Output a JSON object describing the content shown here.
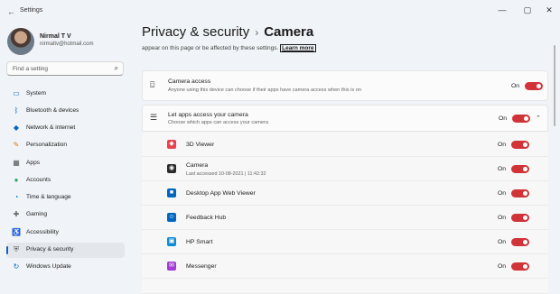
{
  "window": {
    "title": "Settings",
    "minimize": "—",
    "maximize": "▢",
    "close": "✕"
  },
  "user": {
    "name": "Nirmal T V",
    "email": "nirmaltv@hotmail.com"
  },
  "search": {
    "placeholder": "Find a setting",
    "icon": "search-icon"
  },
  "sidebar": {
    "items": [
      {
        "label": "System",
        "icon": "monitor-icon",
        "color": "#0067c0"
      },
      {
        "label": "Bluetooth & devices",
        "icon": "bluetooth-icon",
        "color": "#0067c0"
      },
      {
        "label": "Network & internet",
        "icon": "wifi-diamond-icon",
        "color": "#0067c0"
      },
      {
        "label": "Personalization",
        "icon": "brush-icon",
        "color": "#e07a2e"
      },
      {
        "label": "Apps",
        "icon": "apps-icon",
        "color": "#555555"
      },
      {
        "label": "Accounts",
        "icon": "person-icon",
        "color": "#2fa86b"
      },
      {
        "label": "Time & language",
        "icon": "globe-clock-icon",
        "color": "#0067c0"
      },
      {
        "label": "Gaming",
        "icon": "gamepad-icon",
        "color": "#666666"
      },
      {
        "label": "Accessibility",
        "icon": "accessibility-icon",
        "color": "#0067c0"
      },
      {
        "label": "Privacy & security",
        "icon": "shield-icon",
        "color": "#555555",
        "active": true
      },
      {
        "label": "Windows Update",
        "icon": "update-icon",
        "color": "#0067c0"
      }
    ]
  },
  "header": {
    "parent": "Privacy & security",
    "separator": "›",
    "current": "Camera"
  },
  "intro": {
    "text": "appear on this page or be affected by these settings.",
    "link": "Learn more"
  },
  "camera_access": {
    "title": "Camera access",
    "subtitle": "Anyone using this device can choose if their apps have camera access when this is on",
    "state": "On"
  },
  "let_apps": {
    "title": "Let apps access your camera",
    "subtitle": "Choose which apps can access your camera",
    "state": "On",
    "chevron": "⌃"
  },
  "apps": [
    {
      "name": "3D Viewer",
      "subtitle": "",
      "state": "On",
      "color": "#e8414d",
      "glyph": "◆"
    },
    {
      "name": "Camera",
      "subtitle": "Last accessed 10-08-2021 | 11:42:32",
      "state": "On",
      "color": "#2b2b2b",
      "glyph": "◉"
    },
    {
      "name": "Desktop App Web Viewer",
      "subtitle": "",
      "state": "On",
      "color": "#0067c0",
      "glyph": "■"
    },
    {
      "name": "Feedback Hub",
      "subtitle": "",
      "state": "On",
      "color": "#0067c0",
      "glyph": "☺"
    },
    {
      "name": "HP Smart",
      "subtitle": "",
      "state": "On",
      "color": "#0a8bd6",
      "glyph": "▣"
    },
    {
      "name": "Messenger",
      "subtitle": "",
      "state": "On",
      "color": "#a33bd6",
      "glyph": "✉"
    }
  ],
  "colors": {
    "accent": "#0067c0",
    "toggle_on": "#d13438"
  }
}
